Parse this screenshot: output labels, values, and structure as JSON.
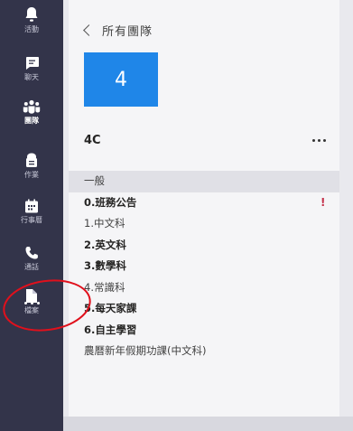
{
  "rail": {
    "items": [
      {
        "label": "活動",
        "icon": "bell-icon"
      },
      {
        "label": "聊天",
        "icon": "chat-icon"
      },
      {
        "label": "團隊",
        "icon": "teams-icon"
      },
      {
        "label": "作業",
        "icon": "assignments-icon"
      },
      {
        "label": "行事曆",
        "icon": "calendar-icon"
      },
      {
        "label": "通話",
        "icon": "phone-icon"
      },
      {
        "label": "檔案",
        "icon": "files-icon"
      }
    ],
    "active": "團隊",
    "more": "more-apps-icon"
  },
  "header": {
    "back_label": "所有團隊"
  },
  "team": {
    "tile_text": "4",
    "name": "4C",
    "tile_color": "#1f86e8"
  },
  "channels": [
    {
      "label": "一般",
      "selected": true,
      "bold": false
    },
    {
      "label": "0.班務公告",
      "bold": true,
      "alert": "!"
    },
    {
      "label": "1.中文科",
      "bold": false
    },
    {
      "label": "2.英文科",
      "bold": true
    },
    {
      "label": "3.數學科",
      "bold": true
    },
    {
      "label": "4.常識科",
      "bold": false
    },
    {
      "label": "5.每天家課",
      "bold": true
    },
    {
      "label": "6.自主學習",
      "bold": true
    },
    {
      "label": "農曆新年假期功課(中文科)",
      "bold": false
    }
  ],
  "colors": {
    "rail": "#33344a",
    "accent": "#1f86e8",
    "alert": "#c4314b",
    "annotation": "#e0101c"
  }
}
